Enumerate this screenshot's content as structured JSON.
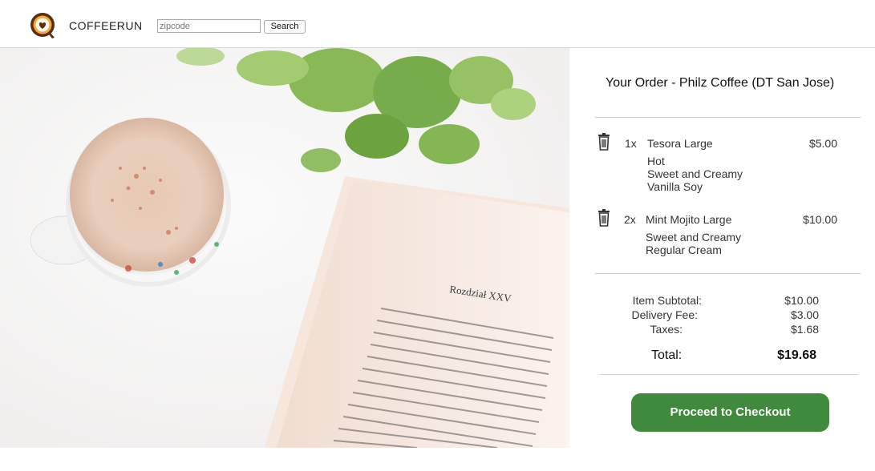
{
  "header": {
    "brand": "COFFEERUN",
    "zip_placeholder": "zipcode",
    "search_label": "Search"
  },
  "order": {
    "title": "Your Order - Philz Coffee (DT San Jose)",
    "items": [
      {
        "qty": "1x",
        "name": "Tesora Large",
        "price": "$5.00",
        "options": [
          "Hot",
          "Sweet and Creamy",
          "Vanilla Soy"
        ]
      },
      {
        "qty": "2x",
        "name": "Mint Mojito Large",
        "price": "$10.00",
        "options": [
          "Sweet and Creamy",
          "Regular Cream"
        ]
      }
    ],
    "summary": {
      "subtotal_label": "Item Subtotal:",
      "subtotal": "$10.00",
      "delivery_label": "Delivery Fee:",
      "delivery": "$3.00",
      "taxes_label": "Taxes:",
      "taxes": "$1.68",
      "total_label": "Total:",
      "total": "$19.68"
    },
    "checkout_label": "Proceed to Checkout"
  },
  "hero": {
    "page_heading": "Rozdział XXV"
  },
  "colors": {
    "accent": "#3f8a3c",
    "logo_brown": "#6b3a1f",
    "logo_orange": "#f0a030"
  }
}
